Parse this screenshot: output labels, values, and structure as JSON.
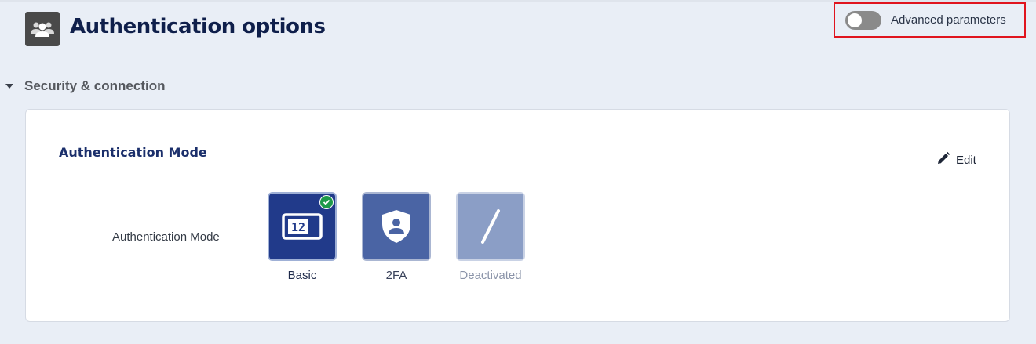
{
  "header": {
    "title": "Authentication options",
    "title_icon": "users-icon"
  },
  "advanced": {
    "label": "Advanced parameters",
    "enabled": false,
    "highlight_color": "#e0141e"
  },
  "section": {
    "label": "Security & connection",
    "expanded": true
  },
  "card": {
    "title": "Authentication Mode",
    "edit_label": "Edit",
    "field_label": "Authentication Mode",
    "options": [
      {
        "label": "Basic",
        "icon": "password-field-icon",
        "selected": true,
        "color": "#213a8a"
      },
      {
        "label": "2FA",
        "icon": "shield-user-icon",
        "selected": false,
        "color": "#4a64a4"
      },
      {
        "label": "Deactivated",
        "icon": "slash-icon",
        "selected": false,
        "color": "#8b9ec6"
      }
    ],
    "selected_badge_color": "#1e9a4a",
    "password_field_text": "12"
  }
}
